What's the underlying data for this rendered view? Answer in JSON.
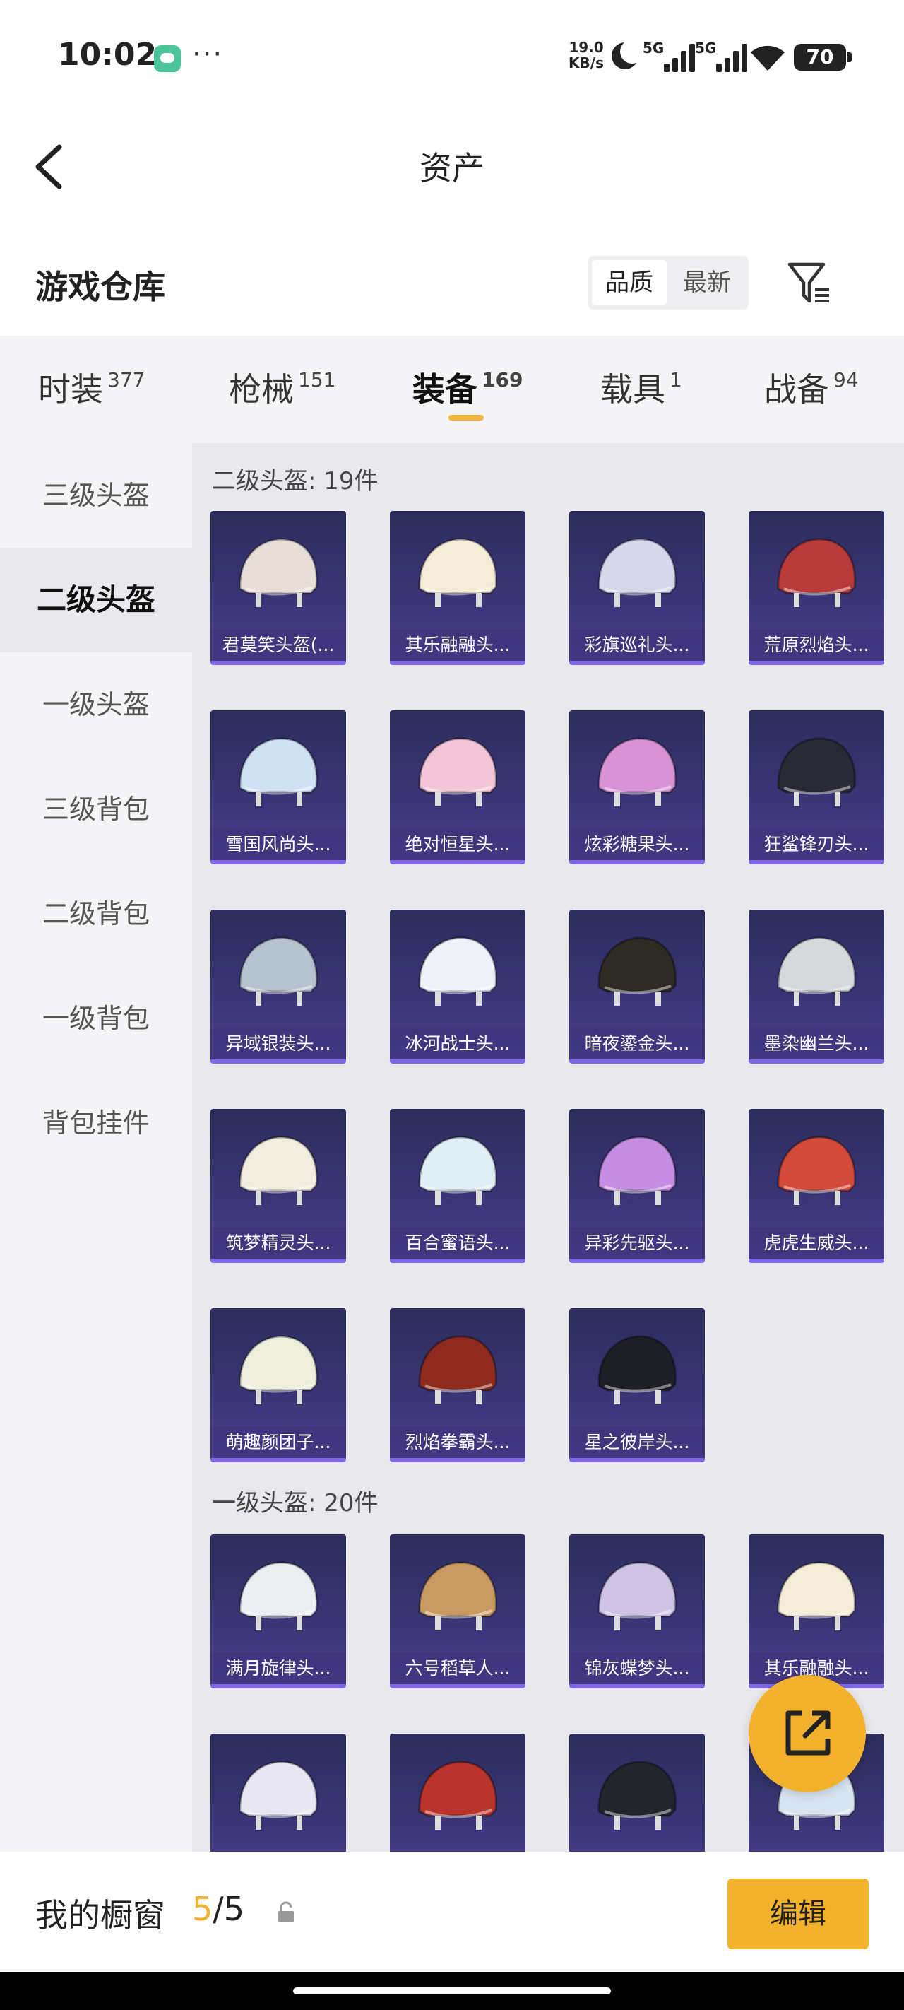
{
  "status_bar": {
    "time": "10:02",
    "dots": "···",
    "speed_value": "19.0",
    "speed_unit": "KB/s",
    "sim1_label": "5G",
    "sim2_label": "5G",
    "battery": "70"
  },
  "header": {
    "title": "资产"
  },
  "warehouse": {
    "title": "游戏仓库",
    "sort_options": [
      "品质",
      "最新"
    ],
    "sort_selected": "品质"
  },
  "tabs": [
    {
      "label": "时装",
      "count": "377"
    },
    {
      "label": "枪械",
      "count": "151"
    },
    {
      "label": "装备",
      "count": "169"
    },
    {
      "label": "载具",
      "count": "1"
    },
    {
      "label": "战备",
      "count": "94"
    }
  ],
  "active_tab": "装备",
  "sidenav": [
    "三级头盔",
    "二级头盔",
    "一级头盔",
    "三级背包",
    "二级背包",
    "一级背包",
    "背包挂件"
  ],
  "sidenav_active": "二级头盔",
  "sections": [
    {
      "title": "二级头盔: 19件",
      "items": [
        {
          "name": "君莫笑头盔(...",
          "color": "#e8ded8"
        },
        {
          "name": "其乐融融头...",
          "color": "#f4ecd6"
        },
        {
          "name": "彩旗巡礼头...",
          "color": "#d8d8ec"
        },
        {
          "name": "荒原烈焰头...",
          "color": "#b83a3a"
        },
        {
          "name": "雪国风尚头...",
          "color": "#cfe2f4"
        },
        {
          "name": "绝对恒星头...",
          "color": "#f2c6d6"
        },
        {
          "name": "炫彩糖果头...",
          "color": "#d992d6"
        },
        {
          "name": "狂鲨锋刃头...",
          "color": "#2a2a36"
        },
        {
          "name": "异域银装头...",
          "color": "#b6c2ce"
        },
        {
          "name": "冰河战士头...",
          "color": "#eef2f8"
        },
        {
          "name": "暗夜鎏金头...",
          "color": "#2e2a24"
        },
        {
          "name": "墨染幽兰头...",
          "color": "#d6d8dc"
        },
        {
          "name": "筑梦精灵头...",
          "color": "#f2ecde"
        },
        {
          "name": "百合蜜语头...",
          "color": "#e2eef6"
        },
        {
          "name": "异彩先驱头...",
          "color": "#c68ee2"
        },
        {
          "name": "虎虎生威头...",
          "color": "#d24a3a"
        },
        {
          "name": "萌趣颜团子...",
          "color": "#eeeedd"
        },
        {
          "name": "烈焰拳霸头...",
          "color": "#8e2a1e"
        },
        {
          "name": "星之彼岸头...",
          "color": "#1e1e26"
        }
      ]
    },
    {
      "title": "一级头盔: 20件",
      "items": [
        {
          "name": "满月旋律头...",
          "color": "#eceef2"
        },
        {
          "name": "六号稻草人...",
          "color": "#c89a62"
        },
        {
          "name": "锦灰蝶梦头...",
          "color": "#cfc4e6"
        },
        {
          "name": "其乐融融头...",
          "color": "#f4ecd6"
        },
        {
          "name": "",
          "color": "#e8e6f2"
        },
        {
          "name": "",
          "color": "#b8342c"
        },
        {
          "name": "",
          "color": "#22242c"
        },
        {
          "name": "",
          "color": "#d8e4f2"
        }
      ]
    }
  ],
  "bottom_bar": {
    "label": "我的橱窗",
    "count_current": "5",
    "count_total": "/5",
    "edit_label": "编辑"
  },
  "colors": {
    "accent": "#f2b22e",
    "card_bg": "#35306c",
    "card_border": "#7f66e6"
  }
}
